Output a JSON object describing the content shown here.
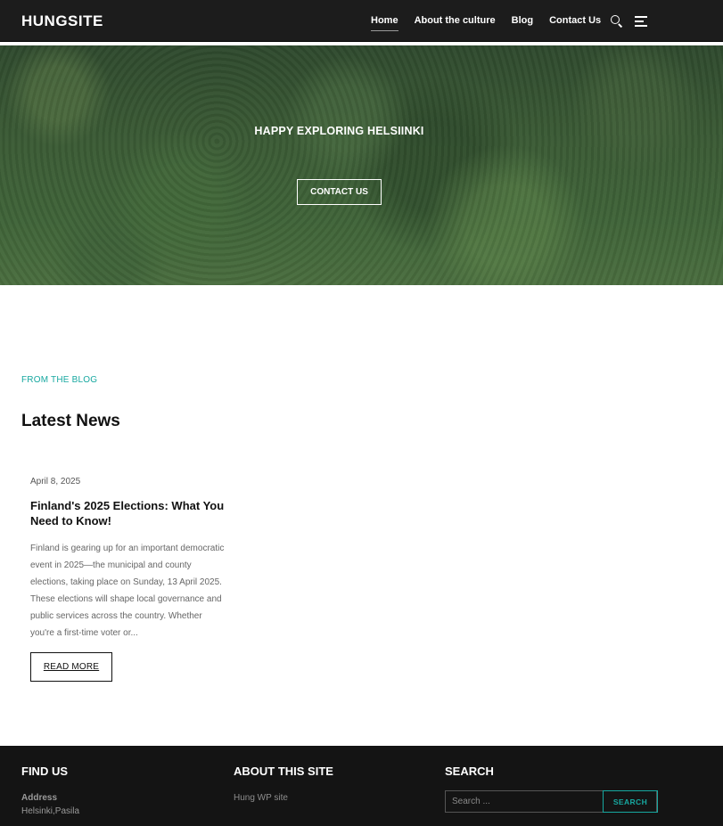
{
  "header": {
    "logo": "HUNGSITE",
    "nav": [
      {
        "label": "Home",
        "active": true
      },
      {
        "label": "About the culture",
        "active": false
      },
      {
        "label": "Blog",
        "active": false
      },
      {
        "label": "Contact Us",
        "active": false
      }
    ],
    "icons": [
      "search-icon",
      "menu-icon"
    ]
  },
  "hero": {
    "title": "HAPPY EXPLORING HELSIINKI",
    "button_label": "CONTACT US"
  },
  "blog": {
    "eyebrow": "FROM THE BLOG",
    "title": "Latest News",
    "posts": [
      {
        "date": "April 8, 2025",
        "title": "Finland's 2025 Elections: What You Need to Know!",
        "excerpt": "Finland is gearing up for an important democratic event in 2025—the municipal and county elections, taking place on Sunday, 13 April 2025. These elections will shape local governance and public services across the country. Whether you're a first-time voter or...",
        "read_more": "READ MORE"
      }
    ]
  },
  "footer": {
    "find_us": {
      "heading": "FIND US",
      "address_label": "Address",
      "address_value": "Helsinki,Pasila"
    },
    "about": {
      "heading": "ABOUT THIS SITE",
      "text": "Hung WP site"
    },
    "search": {
      "heading": "SEARCH",
      "placeholder": "Search ...",
      "button_label": "SEARCH"
    }
  },
  "colors": {
    "accent": "#17a8a0",
    "header_bg": "#1c1c1c",
    "footer_bg": "#141414"
  }
}
